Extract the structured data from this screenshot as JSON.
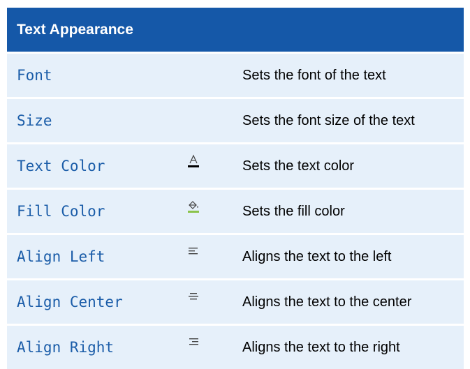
{
  "table": {
    "header": "Text Appearance",
    "rows": [
      {
        "command": "Font",
        "icon": null,
        "description": "Sets the font of the text"
      },
      {
        "command": "Size",
        "icon": null,
        "description": "Sets the font size of the text"
      },
      {
        "command": "Text Color",
        "icon": "text-color-icon",
        "description": "Sets the text color"
      },
      {
        "command": "Fill Color",
        "icon": "fill-color-icon",
        "description": "Sets the fill color"
      },
      {
        "command": "Align Left",
        "icon": "align-left-icon",
        "description": "Aligns the text to the left"
      },
      {
        "command": "Align Center",
        "icon": "align-center-icon",
        "description": "Aligns the text to the center"
      },
      {
        "command": "Align Right",
        "icon": "align-right-icon",
        "description": "Aligns the text to the right"
      }
    ]
  },
  "colors": {
    "header_background": "#1558A8",
    "row_background": "#E6F0FA",
    "command_text": "#1a5ca8",
    "fill_color_underline": "#8BC34A",
    "text_color_underline": "#000000"
  }
}
